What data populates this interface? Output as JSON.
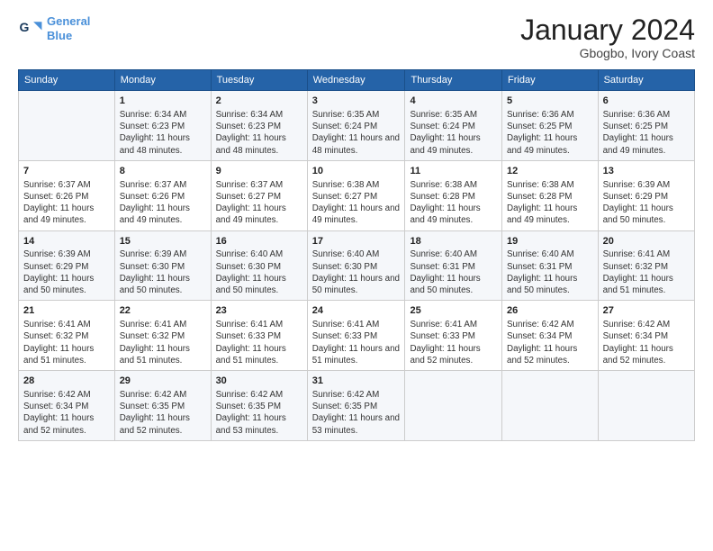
{
  "header": {
    "title": "January 2024",
    "subtitle": "Gbogbo, Ivory Coast",
    "logo_line1": "General",
    "logo_line2": "Blue"
  },
  "weekdays": [
    "Sunday",
    "Monday",
    "Tuesday",
    "Wednesday",
    "Thursday",
    "Friday",
    "Saturday"
  ],
  "weeks": [
    [
      {
        "day": "",
        "sunrise": "",
        "sunset": "",
        "daylight": ""
      },
      {
        "day": "1",
        "sunrise": "Sunrise: 6:34 AM",
        "sunset": "Sunset: 6:23 PM",
        "daylight": "Daylight: 11 hours and 48 minutes."
      },
      {
        "day": "2",
        "sunrise": "Sunrise: 6:34 AM",
        "sunset": "Sunset: 6:23 PM",
        "daylight": "Daylight: 11 hours and 48 minutes."
      },
      {
        "day": "3",
        "sunrise": "Sunrise: 6:35 AM",
        "sunset": "Sunset: 6:24 PM",
        "daylight": "Daylight: 11 hours and 48 minutes."
      },
      {
        "day": "4",
        "sunrise": "Sunrise: 6:35 AM",
        "sunset": "Sunset: 6:24 PM",
        "daylight": "Daylight: 11 hours and 49 minutes."
      },
      {
        "day": "5",
        "sunrise": "Sunrise: 6:36 AM",
        "sunset": "Sunset: 6:25 PM",
        "daylight": "Daylight: 11 hours and 49 minutes."
      },
      {
        "day": "6",
        "sunrise": "Sunrise: 6:36 AM",
        "sunset": "Sunset: 6:25 PM",
        "daylight": "Daylight: 11 hours and 49 minutes."
      }
    ],
    [
      {
        "day": "7",
        "sunrise": "Sunrise: 6:37 AM",
        "sunset": "Sunset: 6:26 PM",
        "daylight": "Daylight: 11 hours and 49 minutes."
      },
      {
        "day": "8",
        "sunrise": "Sunrise: 6:37 AM",
        "sunset": "Sunset: 6:26 PM",
        "daylight": "Daylight: 11 hours and 49 minutes."
      },
      {
        "day": "9",
        "sunrise": "Sunrise: 6:37 AM",
        "sunset": "Sunset: 6:27 PM",
        "daylight": "Daylight: 11 hours and 49 minutes."
      },
      {
        "day": "10",
        "sunrise": "Sunrise: 6:38 AM",
        "sunset": "Sunset: 6:27 PM",
        "daylight": "Daylight: 11 hours and 49 minutes."
      },
      {
        "day": "11",
        "sunrise": "Sunrise: 6:38 AM",
        "sunset": "Sunset: 6:28 PM",
        "daylight": "Daylight: 11 hours and 49 minutes."
      },
      {
        "day": "12",
        "sunrise": "Sunrise: 6:38 AM",
        "sunset": "Sunset: 6:28 PM",
        "daylight": "Daylight: 11 hours and 49 minutes."
      },
      {
        "day": "13",
        "sunrise": "Sunrise: 6:39 AM",
        "sunset": "Sunset: 6:29 PM",
        "daylight": "Daylight: 11 hours and 50 minutes."
      }
    ],
    [
      {
        "day": "14",
        "sunrise": "Sunrise: 6:39 AM",
        "sunset": "Sunset: 6:29 PM",
        "daylight": "Daylight: 11 hours and 50 minutes."
      },
      {
        "day": "15",
        "sunrise": "Sunrise: 6:39 AM",
        "sunset": "Sunset: 6:30 PM",
        "daylight": "Daylight: 11 hours and 50 minutes."
      },
      {
        "day": "16",
        "sunrise": "Sunrise: 6:40 AM",
        "sunset": "Sunset: 6:30 PM",
        "daylight": "Daylight: 11 hours and 50 minutes."
      },
      {
        "day": "17",
        "sunrise": "Sunrise: 6:40 AM",
        "sunset": "Sunset: 6:30 PM",
        "daylight": "Daylight: 11 hours and 50 minutes."
      },
      {
        "day": "18",
        "sunrise": "Sunrise: 6:40 AM",
        "sunset": "Sunset: 6:31 PM",
        "daylight": "Daylight: 11 hours and 50 minutes."
      },
      {
        "day": "19",
        "sunrise": "Sunrise: 6:40 AM",
        "sunset": "Sunset: 6:31 PM",
        "daylight": "Daylight: 11 hours and 50 minutes."
      },
      {
        "day": "20",
        "sunrise": "Sunrise: 6:41 AM",
        "sunset": "Sunset: 6:32 PM",
        "daylight": "Daylight: 11 hours and 51 minutes."
      }
    ],
    [
      {
        "day": "21",
        "sunrise": "Sunrise: 6:41 AM",
        "sunset": "Sunset: 6:32 PM",
        "daylight": "Daylight: 11 hours and 51 minutes."
      },
      {
        "day": "22",
        "sunrise": "Sunrise: 6:41 AM",
        "sunset": "Sunset: 6:32 PM",
        "daylight": "Daylight: 11 hours and 51 minutes."
      },
      {
        "day": "23",
        "sunrise": "Sunrise: 6:41 AM",
        "sunset": "Sunset: 6:33 PM",
        "daylight": "Daylight: 11 hours and 51 minutes."
      },
      {
        "day": "24",
        "sunrise": "Sunrise: 6:41 AM",
        "sunset": "Sunset: 6:33 PM",
        "daylight": "Daylight: 11 hours and 51 minutes."
      },
      {
        "day": "25",
        "sunrise": "Sunrise: 6:41 AM",
        "sunset": "Sunset: 6:33 PM",
        "daylight": "Daylight: 11 hours and 52 minutes."
      },
      {
        "day": "26",
        "sunrise": "Sunrise: 6:42 AM",
        "sunset": "Sunset: 6:34 PM",
        "daylight": "Daylight: 11 hours and 52 minutes."
      },
      {
        "day": "27",
        "sunrise": "Sunrise: 6:42 AM",
        "sunset": "Sunset: 6:34 PM",
        "daylight": "Daylight: 11 hours and 52 minutes."
      }
    ],
    [
      {
        "day": "28",
        "sunrise": "Sunrise: 6:42 AM",
        "sunset": "Sunset: 6:34 PM",
        "daylight": "Daylight: 11 hours and 52 minutes."
      },
      {
        "day": "29",
        "sunrise": "Sunrise: 6:42 AM",
        "sunset": "Sunset: 6:35 PM",
        "daylight": "Daylight: 11 hours and 52 minutes."
      },
      {
        "day": "30",
        "sunrise": "Sunrise: 6:42 AM",
        "sunset": "Sunset: 6:35 PM",
        "daylight": "Daylight: 11 hours and 53 minutes."
      },
      {
        "day": "31",
        "sunrise": "Sunrise: 6:42 AM",
        "sunset": "Sunset: 6:35 PM",
        "daylight": "Daylight: 11 hours and 53 minutes."
      },
      {
        "day": "",
        "sunrise": "",
        "sunset": "",
        "daylight": ""
      },
      {
        "day": "",
        "sunrise": "",
        "sunset": "",
        "daylight": ""
      },
      {
        "day": "",
        "sunrise": "",
        "sunset": "",
        "daylight": ""
      }
    ]
  ]
}
